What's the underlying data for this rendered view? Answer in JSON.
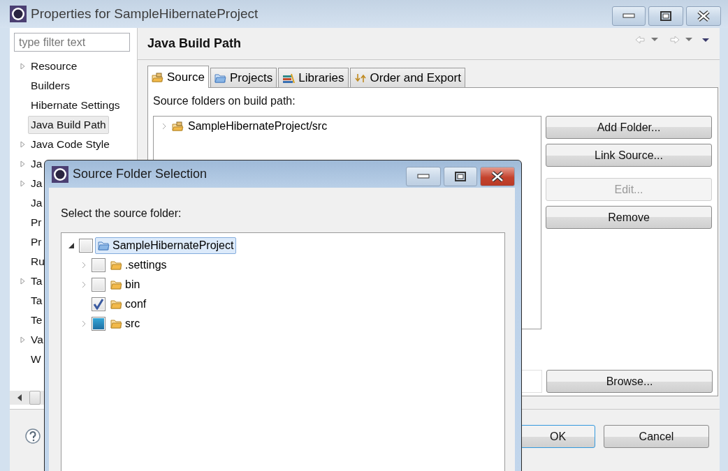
{
  "window": {
    "title": "Properties for SampleHibernateProject"
  },
  "filter": {
    "placeholder": "type filter text"
  },
  "nav_tree": [
    {
      "label": "Resource",
      "expandable": true,
      "selected": false
    },
    {
      "label": "Builders",
      "expandable": false,
      "selected": false
    },
    {
      "label": "Hibernate Settings",
      "expandable": false,
      "selected": false
    },
    {
      "label": "Java Build Path",
      "expandable": false,
      "selected": true
    },
    {
      "label": "Java Code Style",
      "expandable": true,
      "selected": false
    },
    {
      "label": "Ja",
      "expandable": true,
      "selected": false
    },
    {
      "label": "Ja",
      "expandable": true,
      "selected": false
    },
    {
      "label": "Ja",
      "expandable": false,
      "selected": false
    },
    {
      "label": "Pr",
      "expandable": false,
      "selected": false
    },
    {
      "label": "Pr",
      "expandable": false,
      "selected": false
    },
    {
      "label": "Ru",
      "expandable": false,
      "selected": false
    },
    {
      "label": "Ta",
      "expandable": true,
      "selected": false
    },
    {
      "label": "Ta",
      "expandable": false,
      "selected": false
    },
    {
      "label": "Te",
      "expandable": false,
      "selected": false
    },
    {
      "label": "Va",
      "expandable": true,
      "selected": false
    },
    {
      "label": "W",
      "expandable": false,
      "selected": false
    }
  ],
  "page": {
    "title": "Java Build Path",
    "tabs": [
      {
        "label": "Source",
        "selected": true
      },
      {
        "label": "Projects",
        "selected": false
      },
      {
        "label": "Libraries",
        "selected": false
      },
      {
        "label": "Order and Export",
        "selected": false
      }
    ],
    "source_label": "Source folders on build path:",
    "source_folders": [
      {
        "label": "SampleHibernateProject/src"
      }
    ],
    "buttons": [
      {
        "label": "Add Folder...",
        "disabled": false
      },
      {
        "label": "Link Source...",
        "disabled": false
      },
      {
        "label": "Edit...",
        "disabled": true
      },
      {
        "label": "Remove",
        "disabled": false
      }
    ],
    "browse_button": "Browse..."
  },
  "footer_buttons": [
    {
      "label": "OK",
      "focused": true
    },
    {
      "label": "Cancel",
      "focused": false
    }
  ],
  "dialog": {
    "title": "Source Folder Selection",
    "prompt": "Select the source folder:",
    "tree": [
      {
        "label": "SampleHibernateProject",
        "checked": false,
        "partial": false,
        "selected": true,
        "expanded": true,
        "children": [
          {
            "label": ".settings",
            "checked": false,
            "partial": false,
            "selected": false,
            "expandable": true
          },
          {
            "label": "bin",
            "checked": false,
            "partial": false,
            "selected": false,
            "expandable": true
          },
          {
            "label": "conf",
            "checked": true,
            "partial": false,
            "selected": false,
            "expandable": false
          },
          {
            "label": "src",
            "checked": false,
            "partial": true,
            "selected": false,
            "expandable": true
          }
        ]
      }
    ]
  }
}
